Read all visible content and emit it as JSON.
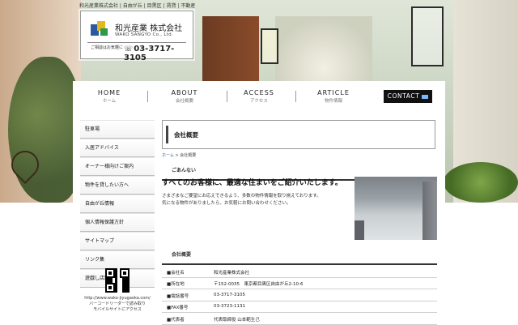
{
  "header": {
    "tagline": "和光産業株式会社 | 自由が丘 | 目黒区 | 賃貸 | 不動産",
    "logo_name": "和光産業 株式会社",
    "logo_en": "WAKO SANGYO Co., Ltd.",
    "contact_label": "ご相談はお気軽に",
    "phone": "03-3717-3105"
  },
  "nav": {
    "items": [
      {
        "en": "HOME",
        "jp": "ホーム"
      },
      {
        "en": "ABOUT",
        "jp": "会社概要"
      },
      {
        "en": "ACCESS",
        "jp": "アクセス"
      },
      {
        "en": "ARTICLE",
        "jp": "物件情報"
      }
    ],
    "contact_label": "CONTACT"
  },
  "sidebar": {
    "items": [
      "駐車場",
      "入居アドバイス",
      "オーナー様向けご案内",
      "物件を貸したい方へ",
      "自由が丘情報",
      "個人情報保護方針",
      "サイトマップ",
      "リンク集",
      "遊戯し店舗"
    ],
    "qr_url": "http://www.wako-jiyugaoka.com/",
    "qr_line2": "バーコードリーダーで読み取り",
    "qr_line3": "モバイルサイトにアクセス"
  },
  "content": {
    "page_title": "会社概要",
    "breadcrumb_home": "ホーム",
    "breadcrumb_sep": ">",
    "breadcrumb_current": "会社概要",
    "section1_label": "ごあんない",
    "greeting": "すべてのお客様に、最適な住まいをご紹介いたします。",
    "intro_line1": "さまざまなご要望にお応えできるよう、多数の物件情報を取り揃えております。",
    "intro_line2": "気になる物件がありましたら、お気軽にお問い合わせください。",
    "section2_label": "会社概要",
    "rows": [
      {
        "k": "■会社名",
        "v": "和光産業株式会社"
      },
      {
        "k": "■所在地",
        "v": "〒152-0035　東京都目黒区自由が丘2-10-6"
      },
      {
        "k": "■電話番号",
        "v": "03-3717-3105"
      },
      {
        "k": "■FAX番号",
        "v": "03-3723-1131"
      },
      {
        "k": "■代表者",
        "v": "代表取締役 山本範生己"
      }
    ]
  },
  "colors": {
    "accent": "#2c5aa0",
    "nav_contact_bg": "#111111"
  }
}
